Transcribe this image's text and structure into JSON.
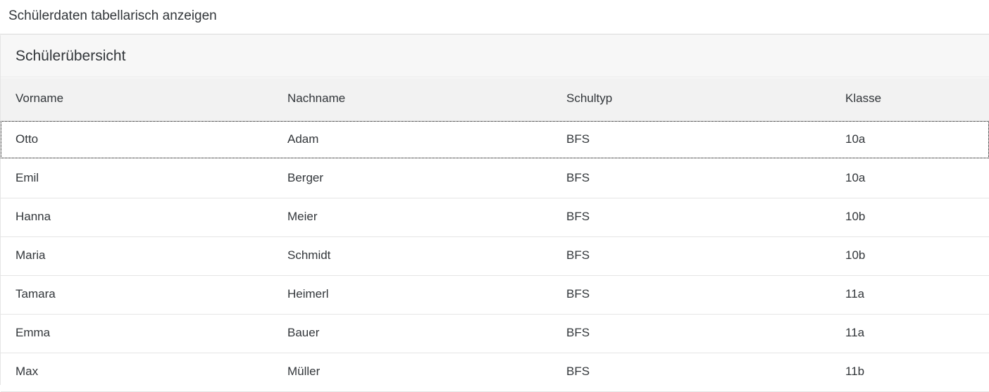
{
  "page": {
    "title": "Schülerdaten tabellarisch anzeigen"
  },
  "table": {
    "title": "Schülerübersicht",
    "columns": [
      "Vorname",
      "Nachname",
      "Schultyp",
      "Klasse"
    ],
    "rows": [
      [
        "Otto",
        "Adam",
        "BFS",
        "10a"
      ],
      [
        "Emil",
        "Berger",
        "BFS",
        "10a"
      ],
      [
        "Hanna",
        "Meier",
        "BFS",
        "10b"
      ],
      [
        "Maria",
        "Schmidt",
        "BFS",
        "10b"
      ],
      [
        "Tamara",
        "Heimerl",
        "BFS",
        "11a"
      ],
      [
        "Emma",
        "Bauer",
        "BFS",
        "11a"
      ],
      [
        "Max",
        "Müller",
        "BFS",
        "11b"
      ]
    ],
    "focused_row": 0
  }
}
